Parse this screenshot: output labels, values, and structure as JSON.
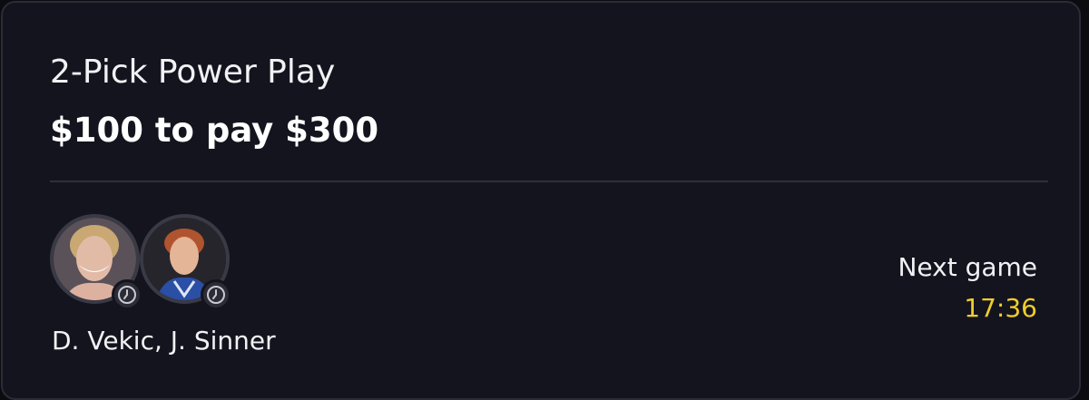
{
  "bet": {
    "title": "2-Pick Power Play",
    "payout": "$100 to pay $300"
  },
  "players": {
    "names": "D. Vekic, J. Sinner",
    "avatars": [
      {
        "icon": "player-avatar-vekic"
      },
      {
        "icon": "player-avatar-sinner"
      }
    ],
    "status_icon": "clock-icon"
  },
  "next_game": {
    "label": "Next game",
    "time": "17:36"
  },
  "colors": {
    "background": "#14141f",
    "time_accent": "#f0cd2c"
  }
}
